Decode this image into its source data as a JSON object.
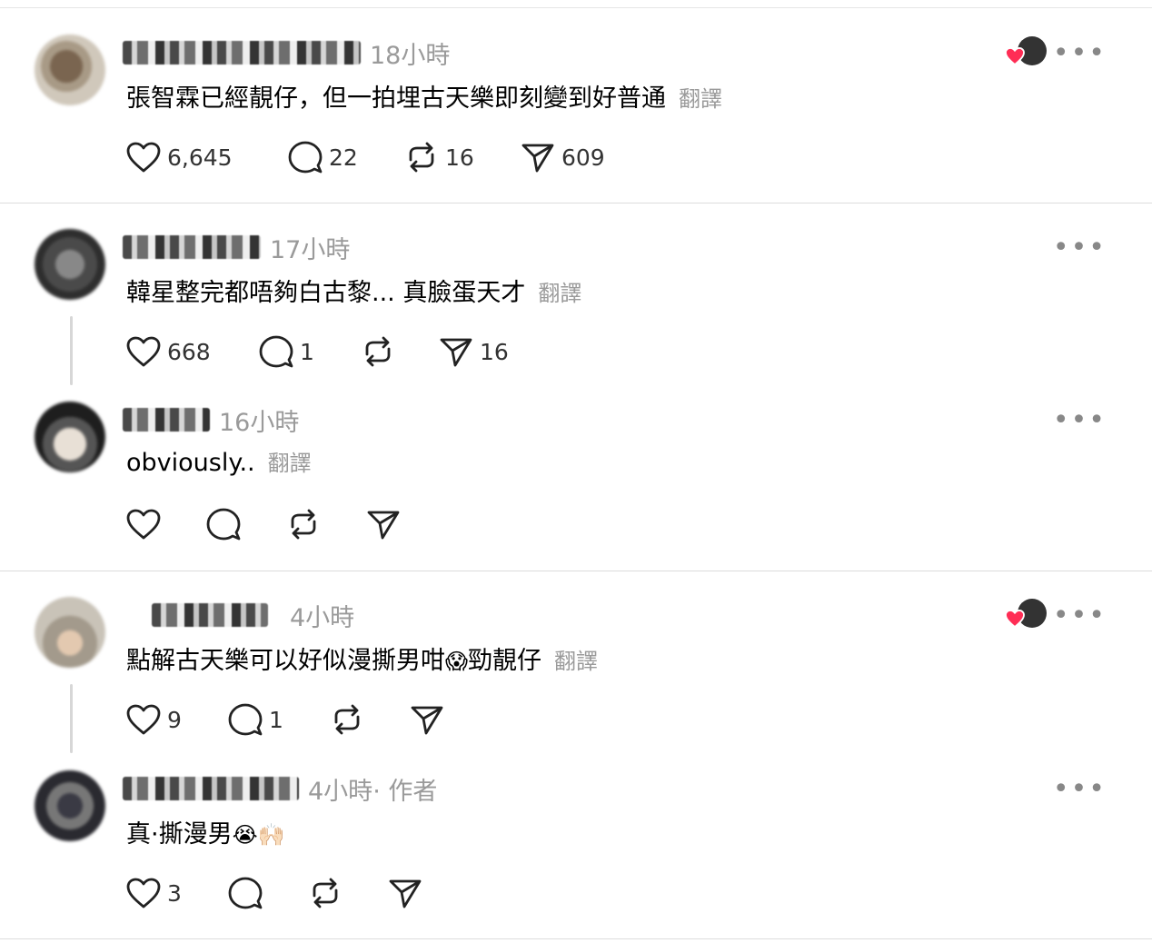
{
  "posts": [
    {
      "time": "18小時",
      "text": "張智霖已經靚仔，但一拍埋古天樂即刻變到好普通",
      "translate": "翻譯",
      "likes": "6,645",
      "replies": "22",
      "reposts": "16",
      "shares": "609",
      "liked_by_author": true
    },
    {
      "time": "17小時",
      "text": "韓星整完都唔夠白古黎... 真臉蛋天才",
      "translate": "翻譯",
      "likes": "668",
      "replies": "1",
      "reposts": "",
      "shares": "16"
    },
    {
      "time": "16小時",
      "text": "obviously..",
      "translate": "翻譯",
      "likes": "",
      "replies": "",
      "reposts": "",
      "shares": ""
    },
    {
      "time": "4小時",
      "text": "點解古天樂可以好似漫撕男咁",
      "emoji": "😱",
      "text_after": "勁靚仔",
      "translate": "翻譯",
      "likes": "9",
      "replies": "1",
      "reposts": "",
      "shares": "",
      "liked_by_author": true
    },
    {
      "time": "4小時",
      "author_tag": " · 作者",
      "text": "真·撕漫男",
      "emoji": "😭🙌🏻",
      "likes": "3",
      "replies": "",
      "reposts": "",
      "shares": ""
    }
  ],
  "icons": {
    "more": "more-horizontal-icon",
    "like": "heart-icon",
    "reply": "comment-icon",
    "repost": "repost-icon",
    "share": "send-icon"
  },
  "colors": {
    "heart": "#ff2d55",
    "muted": "#9a9a9a"
  }
}
